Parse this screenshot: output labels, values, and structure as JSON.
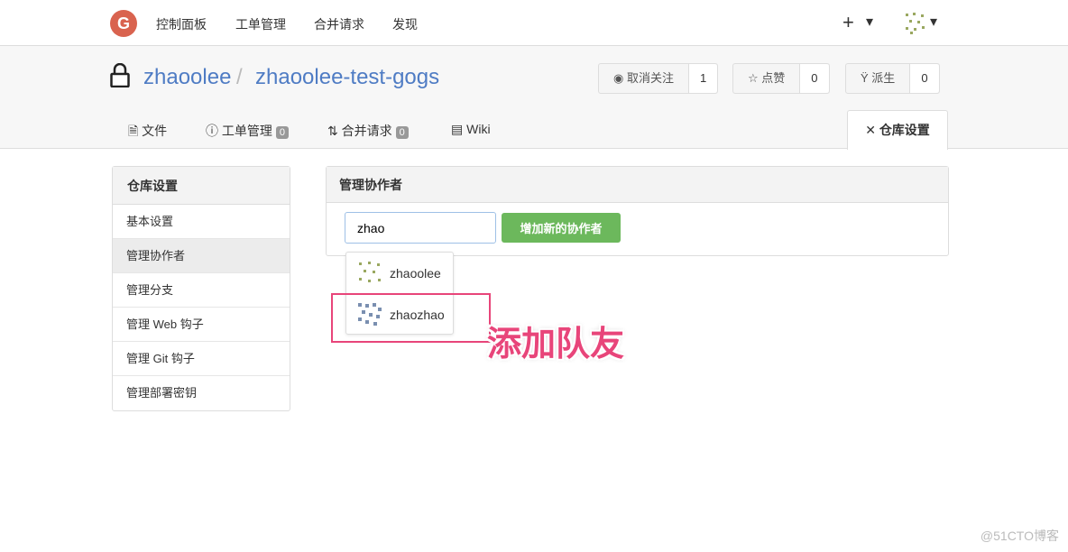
{
  "topnav": {
    "logo": "G",
    "items": [
      "控制面板",
      "工单管理",
      "合并请求",
      "发现"
    ],
    "plus": "+",
    "caret": "▾"
  },
  "repo": {
    "owner": "zhaoolee",
    "sep": "/",
    "name": "zhaoolee-test-gogs"
  },
  "actions": [
    {
      "label": "取消关注",
      "count": "1",
      "icon": "eye-icon"
    },
    {
      "label": "点赞",
      "count": "0",
      "icon": "star-icon"
    },
    {
      "label": "派生",
      "count": "0",
      "icon": "fork-icon"
    }
  ],
  "tabs": [
    {
      "label": "文件"
    },
    {
      "label": "工单管理",
      "badge": "0"
    },
    {
      "label": "合并请求",
      "badge": "0"
    },
    {
      "label": "Wiki"
    }
  ],
  "settings_tab": "仓库设置",
  "sidebar": {
    "title": "仓库设置",
    "items": [
      "基本设置",
      "管理协作者",
      "管理分支",
      "管理 Web 钩子",
      "管理 Git 钩子",
      "管理部署密钥"
    ],
    "active": 1
  },
  "panel": {
    "title": "管理协作者",
    "input_value": "zhao",
    "button": "增加新的协作者",
    "suggestions": [
      "zhaoolee",
      "zhaozhao"
    ]
  },
  "annotation": "添加队友",
  "watermark": "@51CTO博客",
  "colors": {
    "link": "#4f7cc4",
    "button": "#6cb85c",
    "annotation": "#e8457a"
  }
}
